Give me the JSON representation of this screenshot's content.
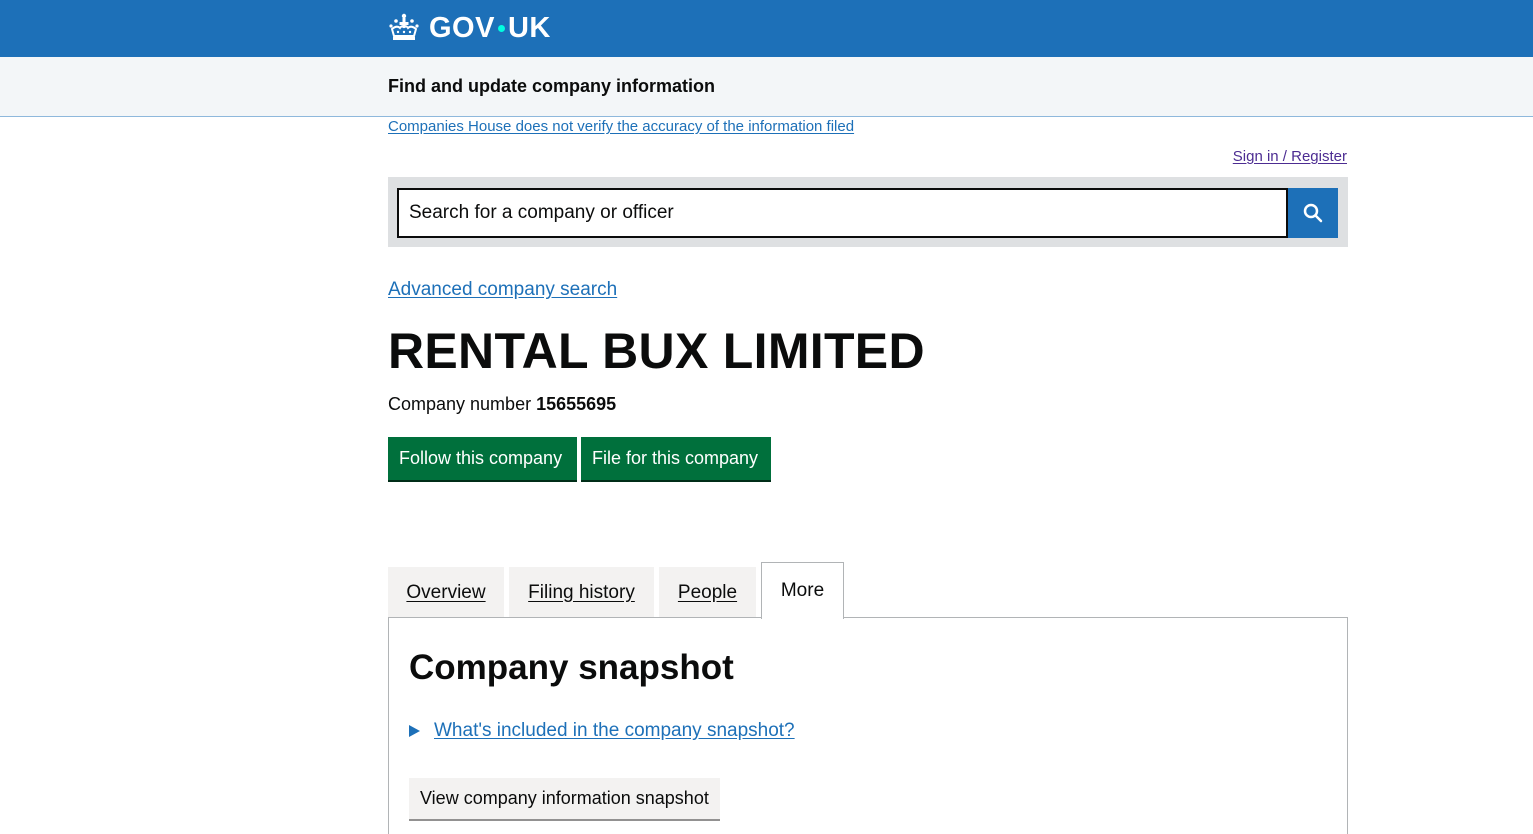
{
  "header": {
    "logo_text_left": "GOV",
    "logo_text_right": "UK",
    "logo_icon": "crown-icon",
    "service_name": "Find and update company information"
  },
  "notices": {
    "disclaimer": "Companies House does not verify the accuracy of the information filed",
    "signin": "Sign in / Register"
  },
  "search": {
    "placeholder": "Search for a company or officer",
    "value": "",
    "button_icon": "search-icon"
  },
  "links": {
    "advanced_search": "Advanced company search"
  },
  "company": {
    "name": "RENTAL BUX LIMITED",
    "number_label": "Company number",
    "number": "15655695"
  },
  "actions": {
    "follow": "Follow this company",
    "file": "File for this company"
  },
  "tabs": [
    {
      "label": "Overview",
      "active": false
    },
    {
      "label": "Filing history",
      "active": false
    },
    {
      "label": "People",
      "active": false
    },
    {
      "label": "More",
      "active": true
    }
  ],
  "snapshot": {
    "title": "Company snapshot",
    "details_summary": "What's included in the company snapshot?",
    "view_button": "View company information snapshot"
  },
  "colors": {
    "header_blue": "#1d70b8",
    "dot_teal": "#00ffe0",
    "green_button": "#00703c",
    "link_blue": "#1d70b8",
    "visited_purple": "#4c2c92"
  }
}
